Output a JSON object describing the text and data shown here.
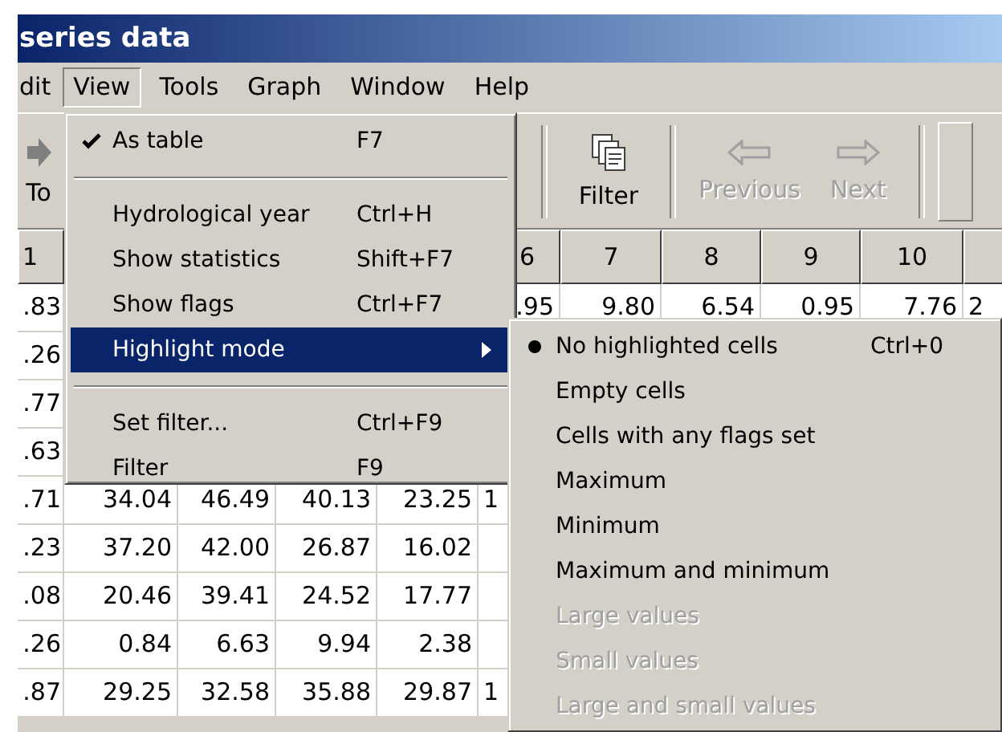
{
  "window": {
    "title": "series data"
  },
  "menu_bar": [
    {
      "label": "dit",
      "open": false
    },
    {
      "label": "View",
      "open": true
    },
    {
      "label": "Tools",
      "open": false
    },
    {
      "label": "Graph",
      "open": false
    },
    {
      "label": "Window",
      "open": false
    },
    {
      "label": "Help",
      "open": false
    }
  ],
  "toolbar": [
    {
      "kind": "arrow",
      "label": "To",
      "disabled": false
    },
    {
      "kind": "filter",
      "label": "Filter",
      "disabled": false
    },
    {
      "kind": "previous",
      "label": "Previous",
      "disabled": true
    },
    {
      "kind": "next",
      "label": "Next",
      "disabled": true
    }
  ],
  "table": {
    "columns": [
      "1",
      null,
      null,
      null,
      null,
      "6",
      "7",
      "8",
      "9",
      "10",
      null
    ],
    "rows": [
      [
        ".83",
        null,
        null,
        null,
        null,
        ".95",
        "9.80",
        "6.54",
        "0.95",
        "7.76",
        "2"
      ],
      [
        ".26",
        null,
        null,
        null,
        null,
        null,
        null,
        null,
        null,
        null,
        null
      ],
      [
        ".77",
        null,
        null,
        null,
        null,
        null,
        null,
        null,
        null,
        null,
        null
      ],
      [
        ".63",
        null,
        null,
        null,
        null,
        null,
        null,
        null,
        null,
        null,
        null
      ],
      [
        ".71",
        "34.04",
        "46.49",
        "40.13",
        "23.25",
        "1",
        null,
        null,
        null,
        null,
        null
      ],
      [
        ".23",
        "37.20",
        "42.00",
        "26.87",
        "16.02",
        null,
        null,
        null,
        null,
        null,
        null
      ],
      [
        ".08",
        "20.46",
        "39.41",
        "24.52",
        "17.77",
        null,
        null,
        null,
        null,
        null,
        null
      ],
      [
        ".26",
        "0.84",
        "6.63",
        "9.94",
        "2.38",
        null,
        null,
        null,
        null,
        null,
        null
      ],
      [
        ".87",
        "29.25",
        "32.58",
        "35.88",
        "29.87",
        "1",
        null,
        null,
        null,
        null,
        null
      ]
    ]
  },
  "view_menu": {
    "items": [
      {
        "kind": "item",
        "label": "As table",
        "shortcut": "F7",
        "checked": true,
        "selected": false,
        "submenu": false
      },
      {
        "kind": "separator"
      },
      {
        "kind": "item",
        "label": "Hydrological year",
        "shortcut": "Ctrl+H",
        "checked": false,
        "selected": false,
        "submenu": false
      },
      {
        "kind": "item",
        "label": "Show statistics",
        "shortcut": "Shift+F7",
        "checked": false,
        "selected": false,
        "submenu": false
      },
      {
        "kind": "item",
        "label": "Show flags",
        "shortcut": "Ctrl+F7",
        "checked": false,
        "selected": false,
        "submenu": false
      },
      {
        "kind": "item",
        "label": "Highlight mode",
        "checked": false,
        "selected": true,
        "submenu": true
      },
      {
        "kind": "separator"
      },
      {
        "kind": "item",
        "label": "Set filter...",
        "shortcut": "Ctrl+F9",
        "checked": false,
        "selected": false,
        "submenu": false
      },
      {
        "kind": "item",
        "label": "Filter",
        "shortcut": "F9",
        "checked": false,
        "selected": false,
        "submenu": false
      }
    ]
  },
  "highlight_submenu": {
    "items": [
      {
        "label": "No highlighted cells",
        "shortcut": "Ctrl+0",
        "selected": true,
        "disabled": false
      },
      {
        "label": "Empty cells",
        "selected": false,
        "disabled": false
      },
      {
        "label": "Cells with any flags set",
        "selected": false,
        "disabled": false
      },
      {
        "label": "Maximum",
        "selected": false,
        "disabled": false
      },
      {
        "label": "Minimum",
        "selected": false,
        "disabled": false
      },
      {
        "label": "Maximum and minimum",
        "selected": false,
        "disabled": false
      },
      {
        "label": "Large values",
        "selected": false,
        "disabled": true
      },
      {
        "label": "Small values",
        "selected": false,
        "disabled": true
      },
      {
        "label": "Large and small values",
        "selected": false,
        "disabled": true
      }
    ]
  }
}
